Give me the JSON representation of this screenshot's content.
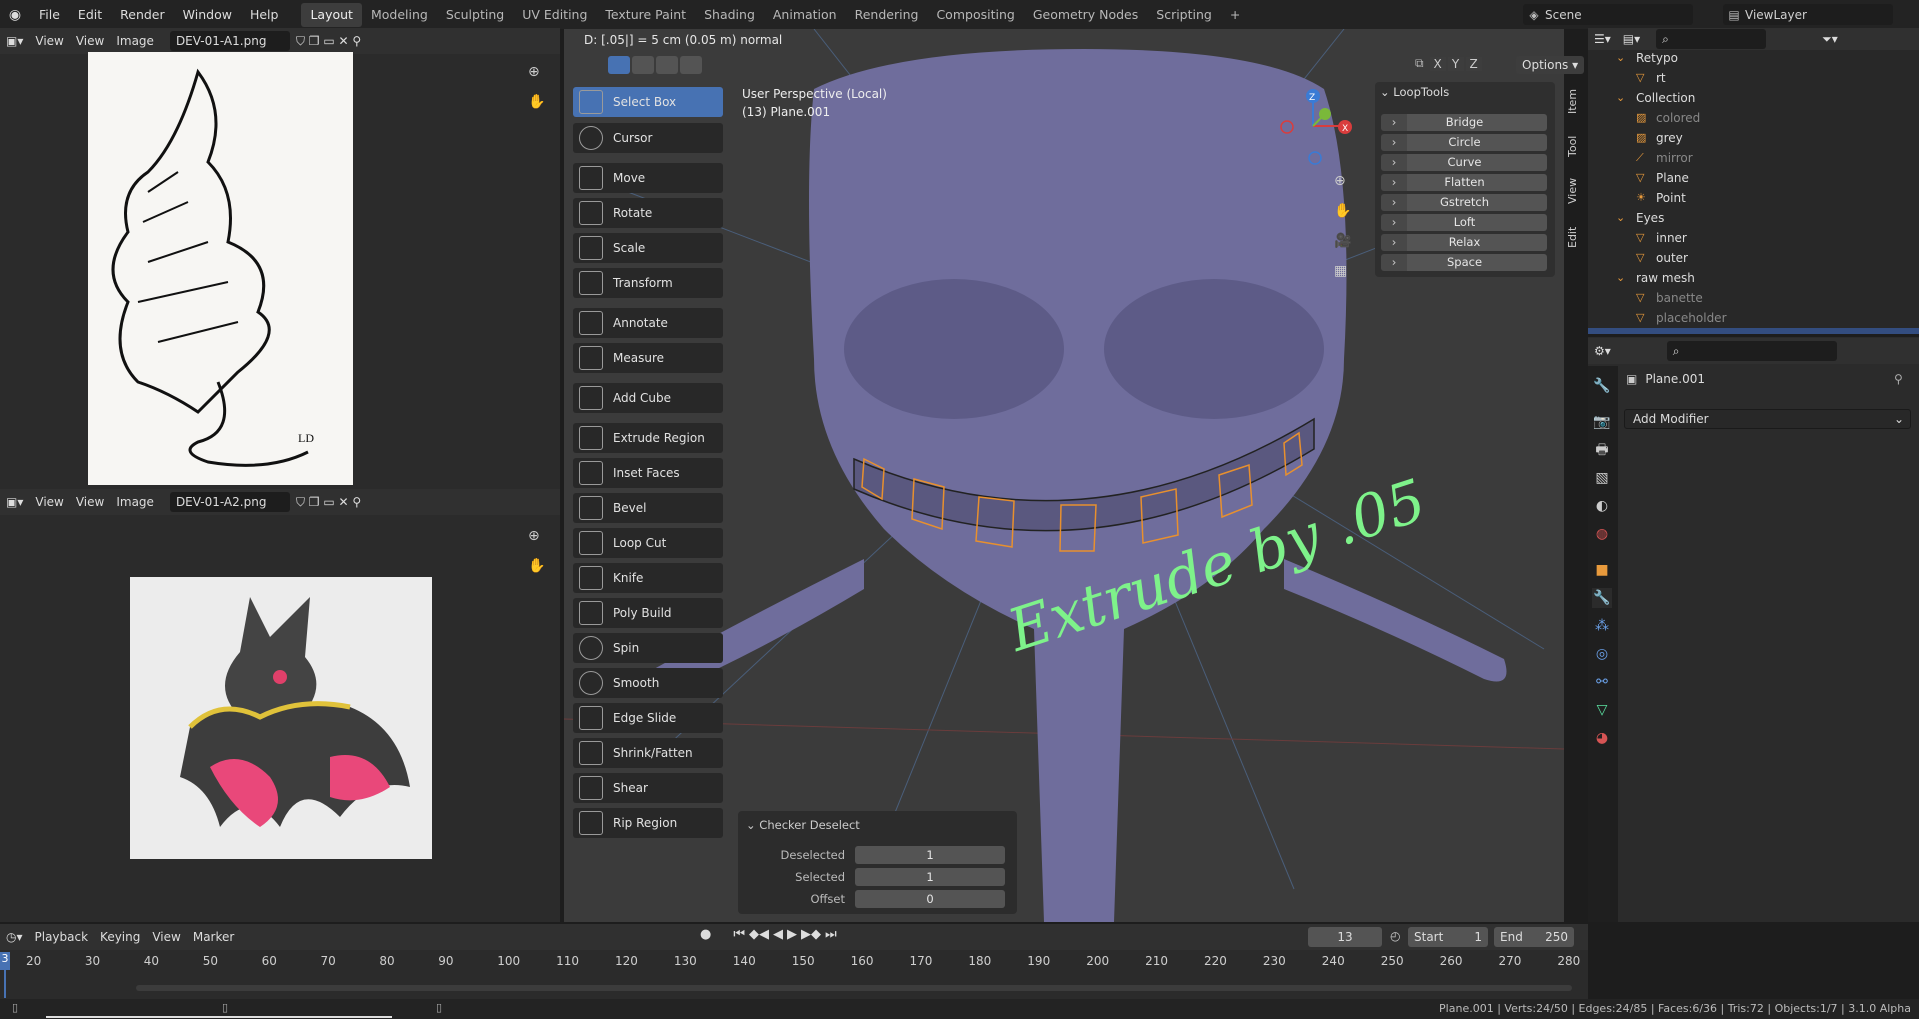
{
  "topbar": {
    "menus": [
      "File",
      "Edit",
      "Render",
      "Window",
      "Help"
    ],
    "workspaces": [
      "Layout",
      "Modeling",
      "Sculpting",
      "UV Editing",
      "Texture Paint",
      "Shading",
      "Animation",
      "Rendering",
      "Compositing",
      "Geometry Nodes",
      "Scripting"
    ],
    "add_tab": "+",
    "scene": "Scene",
    "view_layer": "ViewLayer"
  },
  "image_editor_1": {
    "view": "View",
    "view2": "View",
    "image": "Image",
    "filename": "DEV-01-A1.png"
  },
  "image_editor_2": {
    "view": "View",
    "view2": "View",
    "image": "Image",
    "filename": "DEV-01-A2.png"
  },
  "viewport": {
    "status_text": "D: [.05|] = 5 cm (0.05 m) normal",
    "perspective": "User Perspective (Local)",
    "object_info": "(13) Plane.001",
    "options": "Options",
    "axes": [
      "X",
      "Y",
      "Z"
    ],
    "overlay_text": "Extrude by .05",
    "side_tabs": [
      "Item",
      "Tool",
      "View",
      "Edit"
    ]
  },
  "toolbar": {
    "tools": [
      "Select Box",
      "Cursor",
      "Move",
      "Rotate",
      "Scale",
      "Transform",
      "Annotate",
      "Measure",
      "Add Cube",
      "Extrude Region",
      "Inset Faces",
      "Bevel",
      "Loop Cut",
      "Knife",
      "Poly Build",
      "Spin",
      "Smooth",
      "Edge Slide",
      "Shrink/Fatten",
      "Shear",
      "Rip Region"
    ]
  },
  "looptools": {
    "title": "LoopTools",
    "buttons": [
      "Bridge",
      "Circle",
      "Curve",
      "Flatten",
      "Gstretch",
      "Loft",
      "Relax",
      "Space"
    ]
  },
  "checker_deselect": {
    "title": "Checker Deselect",
    "deselected_label": "Deselected",
    "deselected_value": "1",
    "selected_label": "Selected",
    "selected_value": "1",
    "offset_label": "Offset",
    "offset_value": "0"
  },
  "outliner": {
    "items": [
      "Retypo",
      "rt",
      "Collection",
      "colored",
      "grey",
      "mirror",
      "Plane",
      "Point",
      "Eyes",
      "inner",
      "outer",
      "raw mesh",
      "banette",
      "placeholder"
    ]
  },
  "properties": {
    "object_name": "Plane.001",
    "add_modifier": "Add Modifier"
  },
  "timeline": {
    "playback": "Playback",
    "keying": "Keying",
    "view": "View",
    "marker": "Marker",
    "current_frame": "13",
    "start_label": "Start",
    "start_value": "1",
    "end_label": "End",
    "end_value": "250",
    "ticks": [
      "20",
      "30",
      "40",
      "50",
      "60",
      "70",
      "80",
      "90",
      "100",
      "110",
      "120",
      "130",
      "140",
      "150",
      "160",
      "170",
      "180",
      "190",
      "200",
      "210",
      "220",
      "230",
      "240",
      "250",
      "260",
      "270",
      "280"
    ],
    "current_tick": "3"
  },
  "statusbar": {
    "stats": "Plane.001 | Verts:24/50 | Edges:24/85 | Faces:6/36 | Tris:72 | Objects:1/7 | 3.1.0 Alpha"
  },
  "colors": {
    "selection_blue": "#4772b3",
    "mesh_purple": "#6f6d9c",
    "annotation_green": "#7ef28a",
    "selected_edge_orange": "#e8902e"
  }
}
